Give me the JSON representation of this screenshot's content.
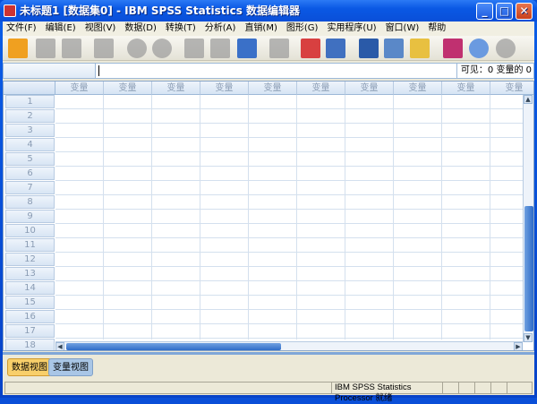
{
  "window": {
    "title": "未标题1 [数据集0] - IBM SPSS Statistics 数据编辑器"
  },
  "menu": [
    "文件(F)",
    "编辑(E)",
    "视图(V)",
    "数据(D)",
    "转换(T)",
    "分析(A)",
    "直销(M)",
    "图形(G)",
    "实用程序(U)",
    "窗口(W)",
    "帮助"
  ],
  "toolbar": [
    {
      "name": "open-icon",
      "color": "#f0a020"
    },
    {
      "name": "save-icon",
      "color": "#9a9a9a"
    },
    {
      "name": "print-icon",
      "color": "#9a9a9a"
    },
    {
      "name": "dialog-recall-icon",
      "color": "#9a9a9a"
    },
    {
      "name": "undo-icon",
      "color": "#9a9a9a"
    },
    {
      "name": "redo-icon",
      "color": "#9a9a9a"
    },
    {
      "name": "goto-case-icon",
      "color": "#9a9a9a"
    },
    {
      "name": "goto-variable-icon",
      "color": "#9a9a9a"
    },
    {
      "name": "variables-icon",
      "color": "#3a70c8"
    },
    {
      "name": "find-icon",
      "color": "#9a9a9a"
    },
    {
      "name": "insert-cases-icon",
      "color": "#d84040"
    },
    {
      "name": "insert-variable-icon",
      "color": "#4070c0"
    },
    {
      "name": "split-file-icon",
      "color": "#2a5aa8"
    },
    {
      "name": "weight-cases-icon",
      "color": "#5a88c8"
    },
    {
      "name": "select-cases-icon",
      "color": "#e8c040"
    },
    {
      "name": "value-labels-icon",
      "color": "#c03070"
    },
    {
      "name": "use-sets-icon",
      "color": "#6a9ae0"
    },
    {
      "name": "show-all-variables-icon",
      "color": "#9a9a9a"
    }
  ],
  "cellbar": {
    "visible_label": "可见：0 变量的 0"
  },
  "grid": {
    "column_header": "变量",
    "rows": [
      "1",
      "2",
      "3",
      "4",
      "5",
      "6",
      "7",
      "8",
      "9",
      "10",
      "11",
      "12",
      "13",
      "14",
      "15",
      "16",
      "17",
      "18"
    ]
  },
  "tabs": {
    "data_view": "数据视图",
    "variable_view": "变量视图"
  },
  "status": {
    "message": "IBM SPSS Statistics Processor 就绪"
  }
}
